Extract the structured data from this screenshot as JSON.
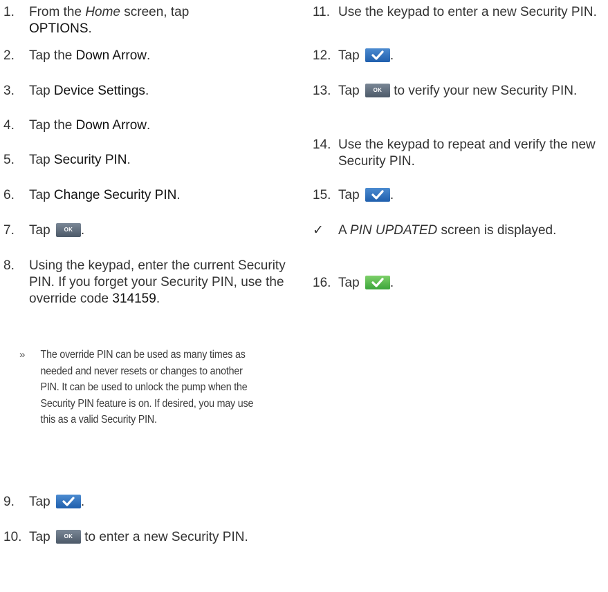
{
  "left": {
    "steps": [
      {
        "num": "1.",
        "pre": "From the ",
        "italic": "Home",
        "mid": " screen, tap",
        "em": "OPTIONS",
        "post": "."
      },
      {
        "num": "2.",
        "pre": "Tap the ",
        "em": "Down Arrow",
        "post": "."
      },
      {
        "num": "3.",
        "pre": "Tap ",
        "em": "Device Settings",
        "post": "."
      },
      {
        "num": "4.",
        "pre": "Tap the ",
        "em": "Down Arrow",
        "post": "."
      },
      {
        "num": "5.",
        "pre": "Tap ",
        "em": "Security PIN",
        "post": "."
      },
      {
        "num": "6.",
        "pre": "Tap ",
        "em": "Change Security PIN",
        "post": "."
      },
      {
        "num": "7.",
        "pre": "Tap",
        "post": "."
      },
      {
        "num": "8.",
        "text": "Using the keypad, enter the current Security PIN. If you forget your Security PIN, use the override code ",
        "em": "314159",
        "post": "."
      },
      {
        "num": "9.",
        "pre": "Tap",
        "post": "."
      },
      {
        "num": "10.",
        "pre": "Tap",
        "post": " to enter a new Security PIN."
      }
    ],
    "note_bullet": "»",
    "note": "The override PIN can be used as many times as needed and never resets or changes to another PIN. It can be used to unlock the pump when the Security PIN feature is on. If desired, you may use this as a valid Security PIN."
  },
  "right": {
    "steps": [
      {
        "num": "11.",
        "text": "Use the keypad to enter a new Security PIN."
      },
      {
        "num": "12.",
        "pre": "Tap",
        "post": "."
      },
      {
        "num": "13.",
        "pre": "Tap",
        "post": " to verify your new Security PIN."
      },
      {
        "num": "14.",
        "text": "Use the keypad to repeat and verify the new Security PIN."
      },
      {
        "num": "15.",
        "pre": "Tap",
        "post": "."
      },
      {
        "num": "16.",
        "pre": "Tap",
        "post": "."
      }
    ],
    "result": {
      "mark": "✓",
      "pre": "A ",
      "italic": "PIN UPDATED",
      "post": " screen is displayed."
    }
  },
  "buttons": {
    "ok_label": "OK"
  },
  "colors": {
    "check_blue": "#2f6fbd",
    "check_green": "#4cb847",
    "ok_gray": "#5f6b79"
  }
}
